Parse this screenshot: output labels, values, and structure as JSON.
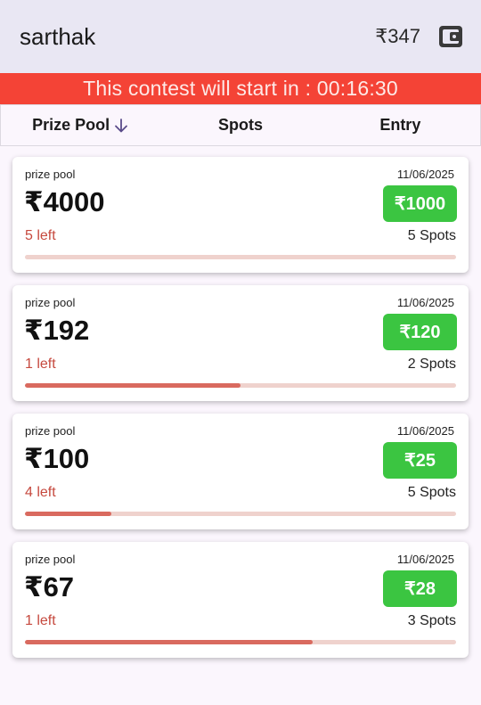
{
  "header": {
    "username": "sarthak",
    "balance": "₹347",
    "wallet_icon": "wallet-icon"
  },
  "timer": {
    "text": "This contest will start in : 00:16:30"
  },
  "sort": {
    "prize_pool_label": "Prize Pool",
    "spots_label": "Spots",
    "entry_label": "Entry",
    "sort_icon": "arrow-down-icon"
  },
  "colors": {
    "timer_bg": "#f44336",
    "entry_btn": "#3bc541",
    "left_text": "#c6493e",
    "progress_fill": "#d96a5f",
    "progress_track": "#efd2cd"
  },
  "contests": [
    {
      "label": "prize pool",
      "date": "11/06/2025",
      "amount": "₹4000",
      "entry": "₹1000",
      "left": "5 left",
      "spots": "5 Spots",
      "filled_fraction": 0.0
    },
    {
      "label": "prize pool",
      "date": "11/06/2025",
      "amount": "₹192",
      "entry": "₹120",
      "left": "1 left",
      "spots": "2 Spots",
      "filled_fraction": 0.5
    },
    {
      "label": "prize pool",
      "date": "11/06/2025",
      "amount": "₹100",
      "entry": "₹25",
      "left": "4 left",
      "spots": "5 Spots",
      "filled_fraction": 0.2
    },
    {
      "label": "prize pool",
      "date": "11/06/2025",
      "amount": "₹67",
      "entry": "₹28",
      "left": "1 left",
      "spots": "3 Spots",
      "filled_fraction": 0.667
    }
  ]
}
